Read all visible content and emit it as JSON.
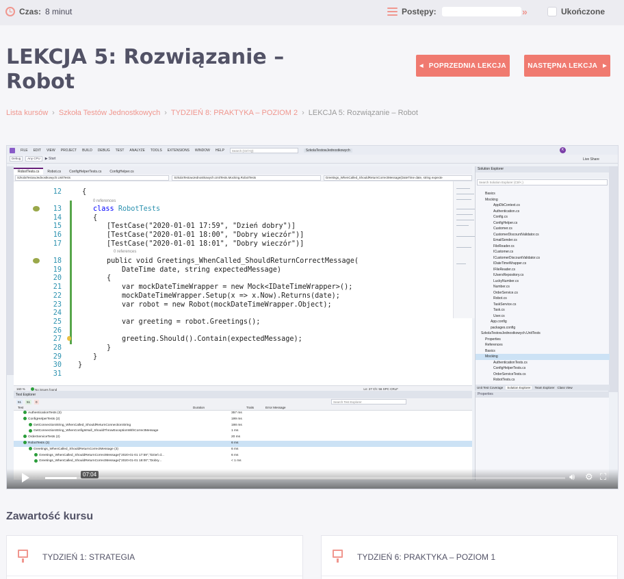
{
  "topbar": {
    "time_label": "Czas:",
    "time_value": "8 minut",
    "progress_label": "Postępy:",
    "completed_label": "Ukończone"
  },
  "lesson": {
    "title": "LEKCJA 5: Rozwiązanie – Robot",
    "prev_button": "POPRZEDNIA LEKCJA",
    "next_button": "NASTĘPNA LEKCJA"
  },
  "breadcrumb": {
    "items": [
      "Lista kursów",
      "Szkoła Testów Jednostkowych",
      "TYDZIEŃ 8: PRAKTYKA – POZIOM 2",
      "LEKCJA 5: Rozwiązanie – Robot"
    ]
  },
  "video": {
    "current_time": "07:04",
    "progress_fraction": 0.06,
    "ide": {
      "menu": [
        "FILE",
        "EDIT",
        "VIEW",
        "PROJECT",
        "BUILD",
        "DEBUG",
        "TEST",
        "ANALYZE",
        "TOOLS",
        "EXTENSIONS",
        "WINDOW",
        "HELP"
      ],
      "search_placeholder": "Search (Ctrl+Q)",
      "solution_name": "SzkolaTestowJednostkowych",
      "avatar": "K",
      "live_share": "Live Share",
      "toolbar": {
        "config": "Debug",
        "platform": "Any CPU",
        "start": "Start"
      },
      "tabs": [
        "RobotTests.cs",
        "Robot.cs",
        "ConfigHelperTests.cs",
        "ConfigHelper.cs"
      ],
      "nav": [
        "SzkolaTestowJednostkowych.UnitTests",
        "SzkolaTestowJednostkowych.UnitTests.Mocking.RobotTests",
        "Greetings_WhenCalled_ShouldReturnCorrectMessage(DateTime date, string expecte"
      ],
      "zoom": "160 %",
      "issues": "No issues found",
      "position": "Ln: 27   Ch: 56   SPC   CRLF",
      "refs0": "0 references",
      "refs1": "0 references",
      "code": {
        "l12": "{",
        "l13_kw": "class",
        "l13_name": "RobotTests",
        "l14": "{",
        "l15": "[TestCase(\"2020-01-01 17:59\", \"Dzień dobry\")]",
        "l16": "[TestCase(\"2020-01-01 18:00\", \"Dobry wieczór\")]",
        "l17": "[TestCase(\"2020-01-01 18:01\", \"Dobry wieczór\")]",
        "l18": "public void Greetings_WhenCalled_ShouldReturnCorrectMessage(",
        "l19": "DateTime date, string expectedMessage)",
        "l20": "{",
        "l21": "var mockDateTimeWrapper = new Mock<IDateTimeWrapper>();",
        "l22": "mockDateTimeWrapper.Setup(x => x.Now).Returns(date);",
        "l23": "var robot = new Robot(mockDateTimeWrapper.Object);",
        "l25": "var greeting = robot.Greetings();",
        "l27": "greeting.Should().Contain(expectedMessage);",
        "l28": "}",
        "l29": "}",
        "l30": "}"
      },
      "solution_explorer": {
        "title": "Solution Explorer",
        "search_placeholder": "Search Solution Explorer (Ctrl+;)",
        "items": [
          "Basics",
          "Mocking",
          "AppDbContext.cs",
          "Authentication.cs",
          "Config.cs",
          "ConfigHelper.cs",
          "Customer.cs",
          "CustomerDiscountValidator.cs",
          "EmailSender.cs",
          "FileReader.cs",
          "ICustomer.cs",
          "ICustomerDiscountValidator.cs",
          "IDateTimeWrapper.cs",
          "IFileReader.cs",
          "IUsersRepository.cs",
          "LuckyNumber.cs",
          "Number.cs",
          "OrderService.cs",
          "Robot.cs",
          "TaskService.cs",
          "Task.cs",
          "User.cs",
          "App.config",
          "packages.config",
          "SzkolaTestowJednostkowych.UnitTests",
          "Properties",
          "References",
          "Basics",
          "Mocking",
          "AuthenticationTests.cs",
          "ConfigHelperTests.cs",
          "OrderServiceTests.cs",
          "RobotTests.cs"
        ],
        "tabs": [
          "Unit Test Coverage",
          "Solution Explorer",
          "Team Explorer",
          "Class View"
        ]
      },
      "properties_title": "Properties",
      "test_explorer": {
        "title": "Test Explorer",
        "search_placeholder": "Search Test Explorer",
        "counts": [
          "51",
          "51",
          "0"
        ],
        "columns": [
          "Test",
          "Duration",
          "Traits",
          "Error Message"
        ],
        "rows": [
          {
            "name": "AuthenticationTests (3)",
            "dur": "357 ms"
          },
          {
            "name": "ConfigHelperTests (2)",
            "dur": "199 ms"
          },
          {
            "name": "GetConnectionString_WhenCalled_ShouldReturnConnectionString",
            "dur": "198 ms"
          },
          {
            "name": "GetConnectionString_WhenConfigIsNull_ShouldThrowExceptionWithCorrectMessage",
            "dur": "1 ms"
          },
          {
            "name": "OrderServiceTests (2)",
            "dur": "20 ms"
          },
          {
            "name": "RobotTests (3)",
            "dur": "6 ms"
          },
          {
            "name": "Greetings_WhenCalled_ShouldReturnCorrectMessage (3)",
            "dur": "6 ms"
          },
          {
            "name": "Greetings_WhenCalled_ShouldReturnCorrectMessage(\"2020-01-01 17:59\",\"Dzień d...",
            "dur": "6 ms"
          },
          {
            "name": "Greetings_WhenCalled_ShouldReturnCorrectMessage(\"2020-01-01 18:00\",\"Dobry...",
            "dur": "< 1 ms"
          }
        ]
      }
    }
  },
  "course": {
    "section_title": "Zawartość kursu",
    "cards": [
      "TYDZIEŃ 1: STRATEGIA",
      "TYDZIEŃ 6: PRAKTYKA – POZIOM 1"
    ]
  },
  "colors": {
    "accent": "#f07a70",
    "accent_light": "#f0968e",
    "title": "#525266"
  }
}
